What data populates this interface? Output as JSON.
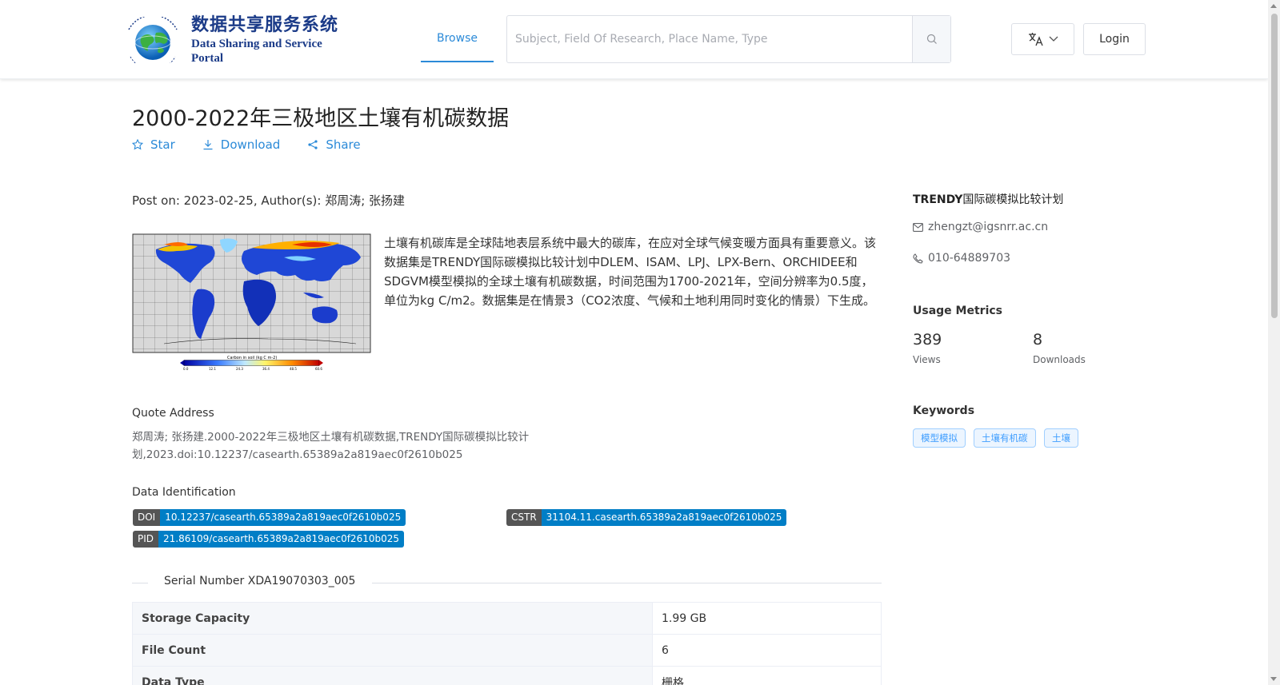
{
  "header": {
    "logo_cn": "数据共享服务系统",
    "logo_en": "Data Sharing and Service Portal",
    "nav_browse": "Browse",
    "search_placeholder": "Subject, Field Of Research, Place Name, Type",
    "login_label": "Login"
  },
  "dataset": {
    "title": "2000-2022年三极地区土壤有机碳数据",
    "actions": {
      "star": "Star",
      "download": "Download",
      "share": "Share"
    },
    "post_on": "Post on: 2023-02-25, Author(s): 郑周涛; 张扬建",
    "abstract": "土壤有机碳库是全球陆地表层系统中最大的碳库，在应对全球气候变暖方面具有重要意义。该数据集是TRENDY国际碳模拟比较计划中DLEM、ISAM、LPJ、LPX-Bern、ORCHIDEE和SDGVM模型模拟的全球土壤有机碳数据，时间范围为1700-2021年，空间分辨率为0.5度，单位为kg C/m2。数据集是在情景3（CO2浓度、气候和土地利用同时变化的情景）下生成。",
    "thumbnail_colorbar_title": "Carbon in soil (kg C m-2)",
    "thumbnail_colorbar_ticks": [
      "0.0",
      "12.1",
      "24.3",
      "36.4",
      "48.5",
      "60.6"
    ],
    "quote_label": "Quote Address",
    "quote_text": "郑周涛; 张扬建.2000-2022年三极地区土壤有机碳数据,TRENDY国际碳模拟比较计划,2023.doi:10.12237/casearth.65389a2a819aec0f2610b025",
    "identification_label": "Data Identification",
    "ids": {
      "doi_key": "DOI",
      "doi_val": "10.12237/casearth.65389a2a819aec0f2610b025",
      "cstr_key": "CSTR",
      "cstr_val": "31104.11.casearth.65389a2a819aec0f2610b025",
      "pid_key": "PID",
      "pid_val": "21.86109/casearth.65389a2a819aec0f2610b025"
    },
    "serial": "Serial Number XDA19070303_005",
    "table": [
      {
        "key": "Storage Capacity",
        "value": "1.99 GB"
      },
      {
        "key": "File Count",
        "value": "6"
      },
      {
        "key": "Data Type",
        "value": "栅格"
      }
    ]
  },
  "sidebar": {
    "org_bold": "TRENDY",
    "org_rest": "国际碳模拟比较计划",
    "email": "zhengzt@igsnrr.ac.cn",
    "phone": "010-64889703",
    "usage_title": "Usage Metrics",
    "views_value": "389",
    "views_label": "Views",
    "downloads_value": "8",
    "downloads_label": "Downloads",
    "keywords_title": "Keywords",
    "keywords": [
      "模型模拟",
      "土壤有机碳",
      "土壤"
    ]
  },
  "colors": {
    "accent": "#2b8ad8",
    "badge_key": "#555555",
    "badge_value": "#007ec6",
    "logo": "#1b3b88"
  }
}
